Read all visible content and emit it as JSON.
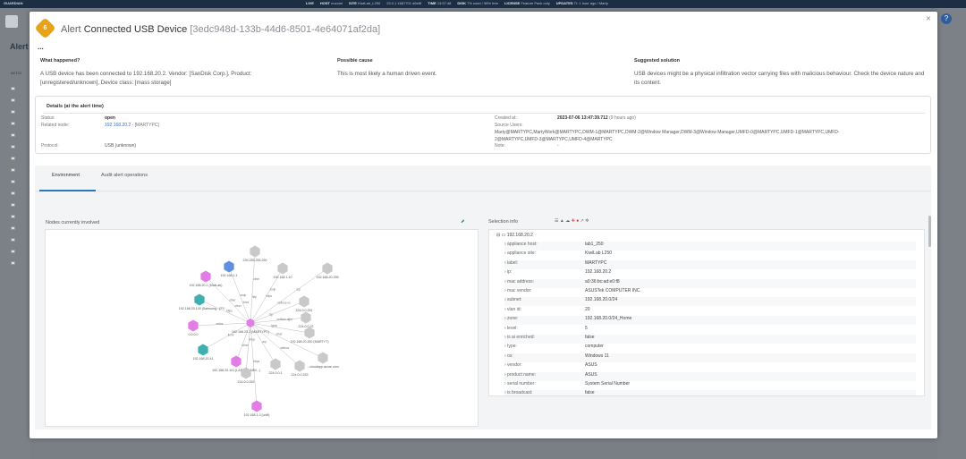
{
  "topbar": {
    "brand": "GUARDIAN",
    "stats": [
      {
        "key": "LIVE",
        "val": ""
      },
      {
        "key": "HOST",
        "val": "nozomi"
      },
      {
        "key": "SITE",
        "val": "KiwiLab_L250"
      },
      {
        "key": "",
        "val": "23.0.1 1687701 d6e8f"
      },
      {
        "key": "TIME",
        "val": "13:57:48"
      },
      {
        "key": "DISK",
        "val": "7% used / 98% free"
      },
      {
        "key": "LICENSE",
        "val": "Feature Pack only"
      },
      {
        "key": "UPDATES",
        "val": "TI: 1 hour ago / Marty"
      }
    ]
  },
  "background": {
    "page_title": "Alert",
    "actions_label": "ACTIO"
  },
  "alert": {
    "severity": "6",
    "type_label": "Alert",
    "name": "Connected USB Device",
    "id": "[3edc948d-133b-44d6-8501-4e64071af2da]",
    "menu": "..."
  },
  "summary": {
    "what_happened": {
      "heading": "What happened?",
      "text": "A USB device has been connected to 192.168.20.2. Vendor: [SanDisk Corp.], Product: [unregistered/unknown], Device class: [mass storage]"
    },
    "possible_cause": {
      "heading": "Possible cause",
      "text": "This is most likely a human driven event."
    },
    "suggested_solution": {
      "heading": "Suggested solution",
      "text": "USB devices might be a physical infiltration vector carrying files with malicious behaviour. Check the device nature and its content."
    }
  },
  "details": {
    "heading": "Details (at the alert time)",
    "status_label": "Status:",
    "status_value": "open",
    "related_node_label": "Related node:",
    "related_node_link": "192.168.20.2",
    "related_node_suffix": "- [MARTYPC]",
    "protocol_label": "Protocol:",
    "protocol_value": "USB (unknown)",
    "created_label": "Created at:",
    "created_value": "2023-07-06 13:47:39.712",
    "created_ago": "(9 hours ago)",
    "source_users_label": "Source Users:",
    "source_users_value_1": "Marty@MARTYPC,MartyWork@MARTYPC,DWM-1@MARTYPC,DWM-2@Window Manager,DWM-3@Window Manager,UMFD-0@MARTYPC,UMFD-1@MARTYPC,UMFD-",
    "source_users_value_2": "2@MARTYPC,UMFD-3@MARTYPC,UMFD-4@MARTYPC",
    "note_label": "Note:",
    "note_value": "-"
  },
  "tabs": [
    {
      "label": "Environment",
      "active": true
    },
    {
      "label": "Audit alert operations",
      "active": false
    }
  ],
  "graph": {
    "title": "Nodes currently involved",
    "nodes": [
      {
        "label": "192.168.20.2 (MARTYPC)",
        "color": "#e27de6",
        "shape": "hex"
      },
      {
        "label": "239.255.255.250",
        "color": "#c9c9c9",
        "shape": "hex"
      },
      {
        "label": "192.168.1.1",
        "color": "#5f90e0",
        "shape": "hex"
      },
      {
        "label": "192.168.1.10",
        "color": "#c9c9c9",
        "shape": "hex"
      },
      {
        "label": "192.168.20.255",
        "color": "#c9c9c9",
        "shape": "hex"
      },
      {
        "label": "192.168.20.1 (KiwiLab)",
        "color": "#e27de6",
        "shape": "hex"
      },
      {
        "label": "192.168.20.100 (Samsung...)",
        "color": "#3fb0b0",
        "shape": "hex"
      },
      {
        "label": "224.0.0.251",
        "color": "#c9c9c9",
        "shape": "hex"
      },
      {
        "label": "224.0.0.22",
        "color": "#c9c9c9",
        "shape": "hex"
      },
      {
        "label": "0.0.0.0",
        "color": "#e27de6",
        "shape": "hex"
      },
      {
        "label": "192.168.20.200 (MARTYT)",
        "color": "#c9c9c9",
        "shape": "hex"
      },
      {
        "label": "192.168.20.41",
        "color": "#3fb0b0",
        "shape": "hex"
      },
      {
        "label": "192.168.20.101 (LAPTOP-M8V...)",
        "color": "#e27de6",
        "shape": "hex"
      },
      {
        "label": "224.0.0.252",
        "color": "#c9c9c9",
        "shape": "hex"
      },
      {
        "label": "224.0.0.1",
        "color": "#c9c9c9",
        "shape": "hex"
      },
      {
        "label": "224.0.0.253",
        "color": "#c9c9c9",
        "shape": "hex"
      },
      {
        "label": "...cloudapp.azure.com",
        "color": "#c9c9c9",
        "shape": "hex"
      },
      {
        "label": "192.168.1.3 (unifi)",
        "color": "#e27de6",
        "shape": "hex"
      }
    ],
    "edge_labels": [
      "http",
      "ssdp",
      "ssdp",
      "netbios-ns",
      "other",
      "dns",
      "tcp",
      "netbios-dgm",
      "mdns",
      "igmp",
      "llmnr",
      "other",
      "dhcp",
      "arp",
      "netbios",
      "other",
      "https",
      "other",
      "llmnr",
      "https",
      "tcp",
      "other",
      "https"
    ]
  },
  "selection": {
    "title": "Selection info",
    "root": "192.168.20.2",
    "rows": [
      {
        "key": "appliance host:",
        "value": "lab1_250"
      },
      {
        "key": "appliance site:",
        "value": "KiwiLab L250"
      },
      {
        "key": "label:",
        "value": "MARTYPC"
      },
      {
        "key": "ip:",
        "value": "192.168.20.2"
      },
      {
        "key": "mac address:",
        "value": "a0:36:bc:ad:e0:f8"
      },
      {
        "key": "mac vendor:",
        "value": "ASUSTek COMPUTER INC."
      },
      {
        "key": "subnet:",
        "value": "192.168.20.0/24"
      },
      {
        "key": "vlan id:",
        "value": "20"
      },
      {
        "key": "zone:",
        "value": "192.168.20.0/24_Home"
      },
      {
        "key": "level:",
        "value": "5"
      },
      {
        "key": "is ai enriched:",
        "value": "false"
      },
      {
        "key": "type:",
        "value": "computer"
      },
      {
        "key": "os:",
        "value": "Windows 11"
      },
      {
        "key": "vendor:",
        "value": "ASUS"
      },
      {
        "key": "product name:",
        "value": "ASUS"
      },
      {
        "key": "serial number:",
        "value": "System Serial Number"
      },
      {
        "key": "is broadcast:",
        "value": "false"
      }
    ]
  },
  "colors": {
    "severity": "#e6a21a",
    "accent": "#2f74c0",
    "topbar": "#1d2e44"
  }
}
